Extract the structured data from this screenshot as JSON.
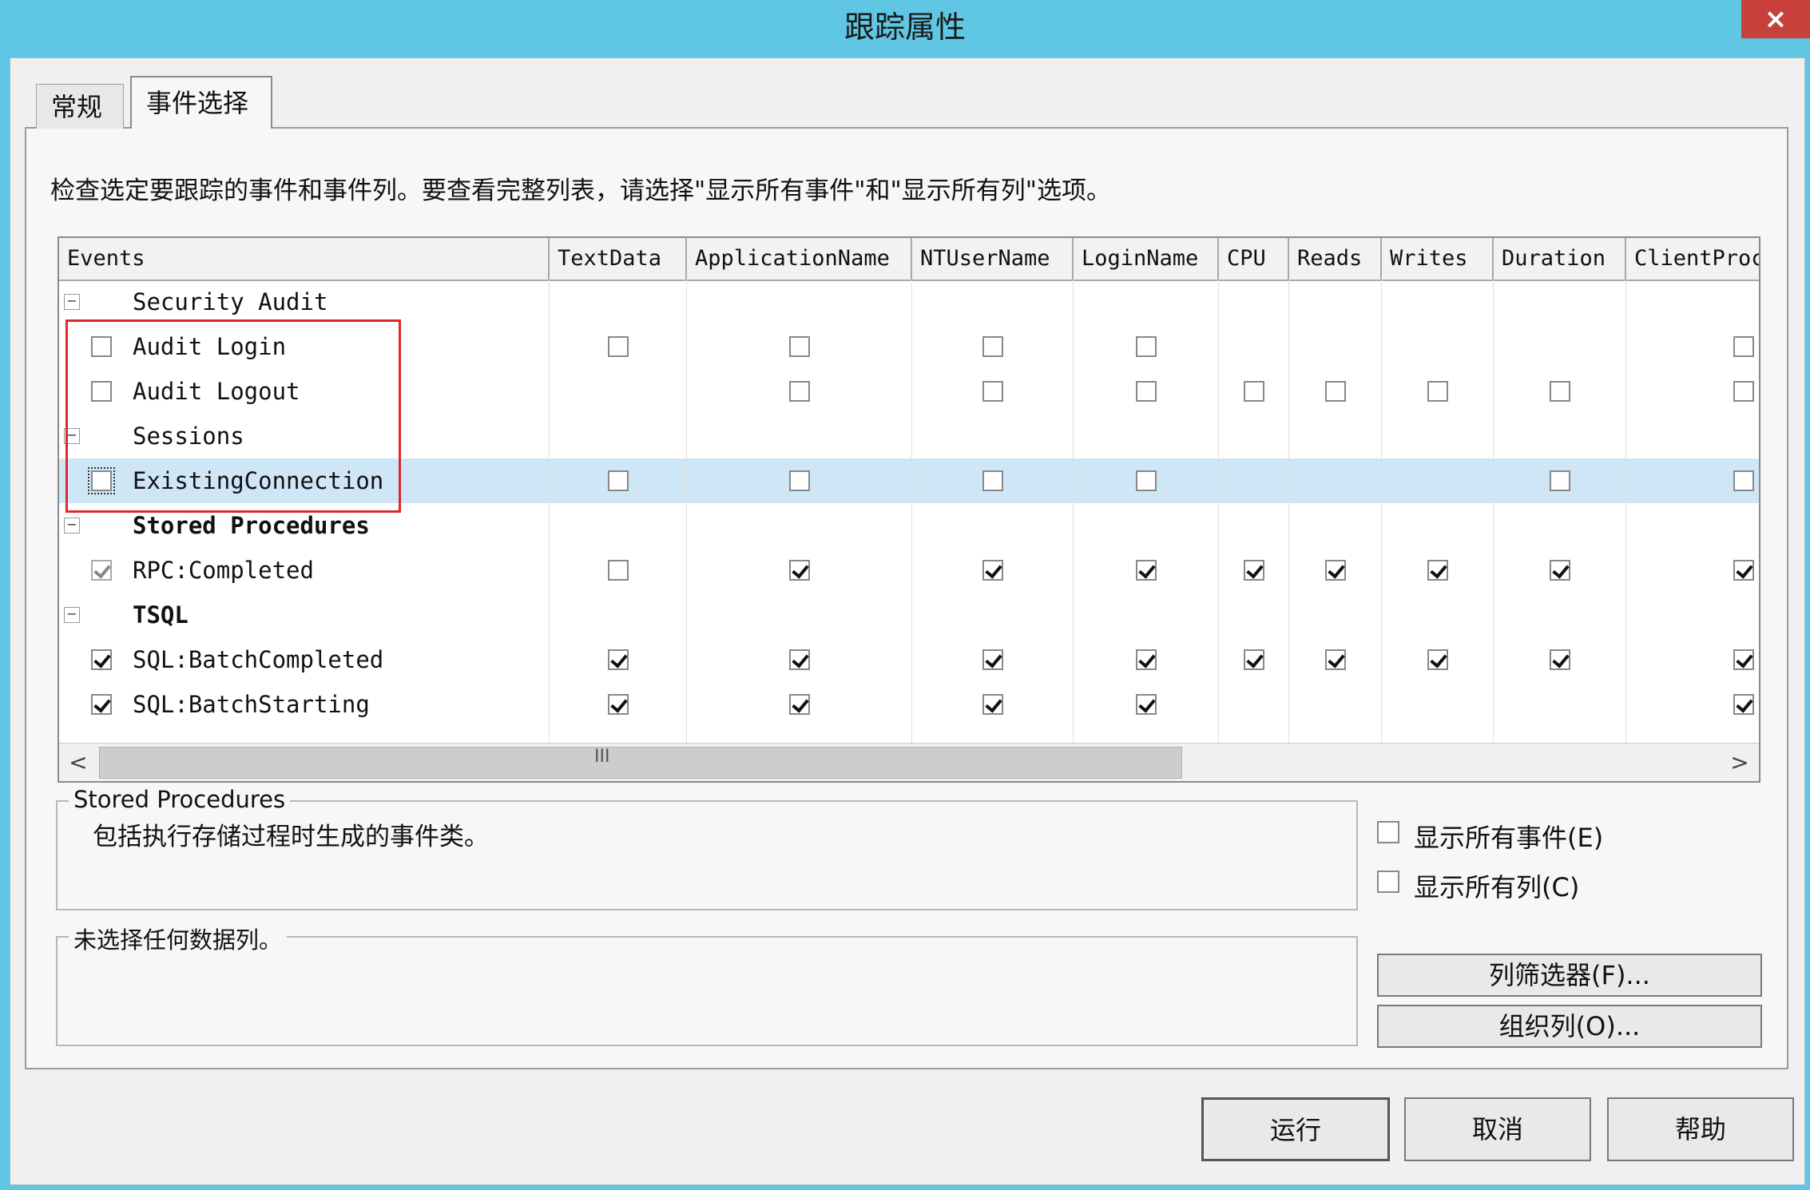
{
  "window": {
    "title": "跟踪属性",
    "close": "×"
  },
  "tabs": [
    {
      "label": "常规"
    },
    {
      "label": "事件选择"
    }
  ],
  "instructions": "检查选定要跟踪的事件和事件列。要查看完整列表，请选择\"显示所有事件\"和\"显示所有列\"选项。",
  "grid": {
    "columns": [
      "Events",
      "TextData",
      "ApplicationName",
      "NTUserName",
      "LoginName",
      "CPU",
      "Reads",
      "Writes",
      "Duration",
      "ClientProc"
    ],
    "rows": [
      {
        "type": "category",
        "label": "Security Audit",
        "expander": "−",
        "bold": false
      },
      {
        "type": "event",
        "label": "Audit Login",
        "checked": false,
        "cells": [
          false,
          false,
          false,
          false,
          null,
          null,
          null,
          null,
          false
        ]
      },
      {
        "type": "event",
        "label": "Audit Logout",
        "checked": false,
        "cells": [
          null,
          false,
          false,
          false,
          false,
          false,
          false,
          false,
          false
        ]
      },
      {
        "type": "category",
        "label": "Sessions",
        "expander": "−",
        "bold": false
      },
      {
        "type": "event",
        "label": "ExistingConnection",
        "checked": false,
        "selected": true,
        "cells": [
          false,
          false,
          false,
          false,
          null,
          null,
          null,
          false,
          false
        ]
      },
      {
        "type": "category",
        "label": "Stored Procedures",
        "expander": "−",
        "bold": true
      },
      {
        "type": "event",
        "label": "RPC:Completed",
        "checked": true,
        "disabled": true,
        "cells": [
          false,
          true,
          true,
          true,
          true,
          true,
          true,
          true,
          true
        ]
      },
      {
        "type": "category",
        "label": "TSQL",
        "expander": "−",
        "bold": true
      },
      {
        "type": "event",
        "label": "SQL:BatchCompleted",
        "checked": true,
        "cells": [
          true,
          true,
          true,
          true,
          true,
          true,
          true,
          true,
          true
        ]
      },
      {
        "type": "event",
        "label": "SQL:BatchStarting",
        "checked": true,
        "cells": [
          true,
          true,
          true,
          true,
          null,
          null,
          null,
          null,
          true
        ]
      }
    ],
    "scrollbar": {
      "left": "<",
      "right": ">",
      "grip": "III"
    }
  },
  "description": {
    "title": "Stored Procedures",
    "text": "包括执行存储过程时生成的事件类。"
  },
  "column_info": {
    "title": "未选择任何数据列。"
  },
  "options": {
    "show_all_events": "显示所有事件(E)",
    "show_all_columns": "显示所有列(C)"
  },
  "buttons": {
    "column_filters": "列筛选器(F)...",
    "organize_columns": "组织列(O)...",
    "run": "运行",
    "cancel": "取消",
    "help": "帮助"
  },
  "colors": {
    "titlebar": "#5fc6e3",
    "selection": "#cfe6f7",
    "highlight": "#e02828",
    "close": "#c7403a"
  }
}
